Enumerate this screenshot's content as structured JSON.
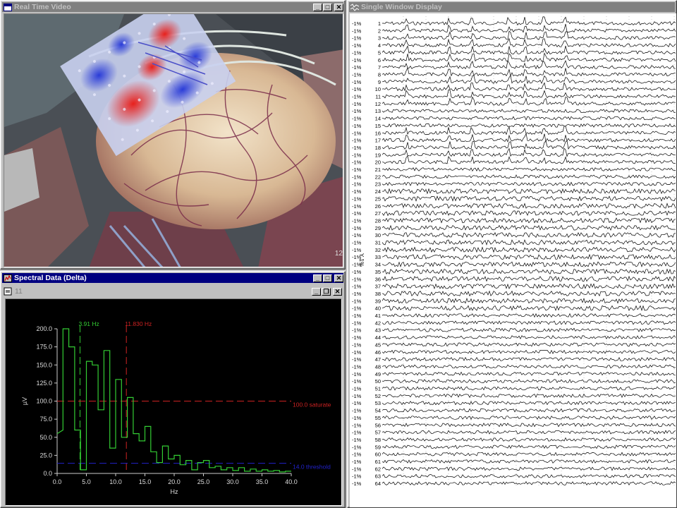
{
  "video_window": {
    "title": "Real Time Video",
    "overlay_number": "12"
  },
  "spectral_window": {
    "title": "Spectral Data (Delta)",
    "child_title": "11"
  },
  "eeg_window": {
    "title": "Single Window Display",
    "scale_label": "1%",
    "side_label": "Y 1%",
    "channels": [
      "1",
      "2",
      "3",
      "4",
      "5",
      "6",
      "7",
      "8",
      "9",
      "10",
      "11",
      "12",
      "13",
      "14",
      "15",
      "16",
      "17",
      "18",
      "19",
      "20",
      "21",
      "22",
      "23",
      "24",
      "25",
      "26",
      "27",
      "28",
      "29",
      "30",
      "31",
      "32",
      "33",
      "34",
      "35",
      "36",
      "37",
      "38",
      "39",
      "40",
      "41",
      "42",
      "43",
      "44",
      "45",
      "46",
      "47",
      "48",
      "49",
      "50",
      "51",
      "52",
      "53",
      "54",
      "55",
      "56",
      "57",
      "58",
      "59",
      "60",
      "61",
      "62",
      "63",
      "64"
    ]
  },
  "chart_data": {
    "type": "line",
    "title": "",
    "xlabel": "Hz",
    "ylabel": "µV",
    "xlim": [
      0,
      40
    ],
    "ylim": [
      0,
      200
    ],
    "x_ticks": [
      "0.0",
      "5.0",
      "10.0",
      "15.0",
      "20.0",
      "25.0",
      "30.0",
      "35.0",
      "40.0"
    ],
    "y_ticks": [
      "0.0",
      "25.0",
      "50.0",
      "75.0",
      "100.0",
      "125.0",
      "150.0",
      "175.0",
      "200.0"
    ],
    "series": [
      {
        "color": "#33cc33",
        "step": true,
        "points": [
          [
            0,
            55
          ],
          [
            1,
            60
          ],
          [
            1,
            200
          ],
          [
            2,
            200
          ],
          [
            2,
            175
          ],
          [
            3,
            175
          ],
          [
            3,
            60
          ],
          [
            4,
            60
          ],
          [
            4,
            5
          ],
          [
            5,
            5
          ],
          [
            5,
            155
          ],
          [
            6,
            155
          ],
          [
            6,
            150
          ],
          [
            7,
            150
          ],
          [
            7,
            88
          ],
          [
            8,
            88
          ],
          [
            8,
            170
          ],
          [
            9,
            170
          ],
          [
            9,
            35
          ],
          [
            10,
            35
          ],
          [
            10,
            130
          ],
          [
            11,
            130
          ],
          [
            11,
            50
          ],
          [
            12,
            50
          ],
          [
            12,
            105
          ],
          [
            13,
            105
          ],
          [
            13,
            55
          ],
          [
            14,
            55
          ],
          [
            14,
            45
          ],
          [
            15,
            45
          ],
          [
            15,
            65
          ],
          [
            16,
            65
          ],
          [
            16,
            30
          ],
          [
            17,
            30
          ],
          [
            17,
            15
          ],
          [
            18,
            15
          ],
          [
            18,
            38
          ],
          [
            19,
            38
          ],
          [
            19,
            20
          ],
          [
            20,
            20
          ],
          [
            20,
            25
          ],
          [
            21,
            25
          ],
          [
            21,
            12
          ],
          [
            22,
            12
          ],
          [
            22,
            18
          ],
          [
            23,
            18
          ],
          [
            23,
            5
          ],
          [
            24,
            5
          ],
          [
            24,
            15
          ],
          [
            25,
            15
          ],
          [
            25,
            18
          ],
          [
            26,
            18
          ],
          [
            26,
            8
          ],
          [
            27,
            8
          ],
          [
            27,
            10
          ],
          [
            28,
            10
          ],
          [
            28,
            5
          ],
          [
            29,
            5
          ],
          [
            29,
            8
          ],
          [
            30,
            8
          ],
          [
            30,
            4
          ],
          [
            31,
            4
          ],
          [
            31,
            8
          ],
          [
            32,
            8
          ],
          [
            32,
            3
          ],
          [
            33,
            3
          ],
          [
            33,
            6
          ],
          [
            34,
            6
          ],
          [
            34,
            3
          ],
          [
            35,
            3
          ],
          [
            35,
            5
          ],
          [
            36,
            5
          ],
          [
            36,
            3
          ],
          [
            37,
            3
          ],
          [
            37,
            4
          ],
          [
            38,
            4
          ],
          [
            38,
            2
          ],
          [
            39,
            2
          ],
          [
            39,
            3
          ],
          [
            40,
            3
          ]
        ]
      }
    ],
    "markers": [
      {
        "type": "vline",
        "x": 3.91,
        "label": "3.91 Hz",
        "color": "#33cc33"
      },
      {
        "type": "vline",
        "x": 11.83,
        "label": "11.830 Hz",
        "color": "#cc2222"
      },
      {
        "type": "hline",
        "y": 100,
        "label": "100.0 saturate",
        "color": "#cc2222"
      },
      {
        "type": "hline",
        "y": 14,
        "label": "14.0 threshold",
        "color": "#2222cc"
      }
    ]
  },
  "colors": {
    "title_active": "#000080",
    "title_inactive": "#808080",
    "trace_green": "#33cc33",
    "marker_red": "#cc2222",
    "marker_blue": "#2222cc",
    "eeg_trace": "#000000"
  }
}
